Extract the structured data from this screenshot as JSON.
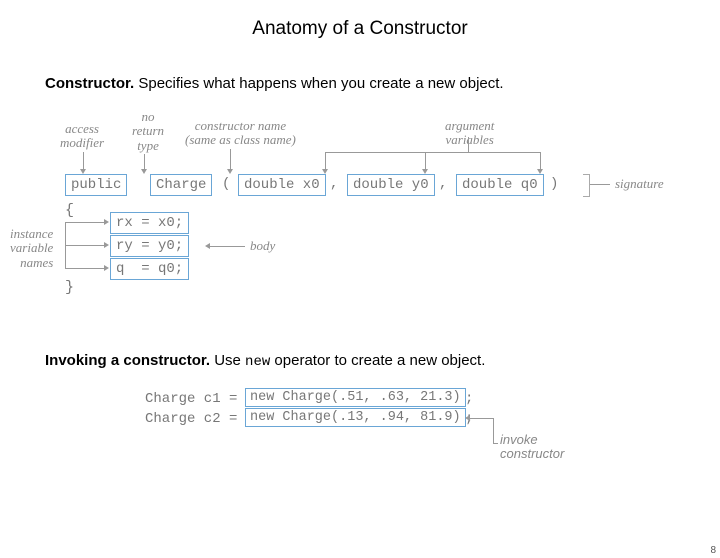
{
  "title": "Anatomy of a Constructor",
  "para1_bold": "Constructor.",
  "para1_rest": "  Specifies what happens when you create a new object.",
  "annotations": {
    "access_modifier": "access\nmodifier",
    "no_return_type": "no\nreturn\ntype",
    "constructor_name": "constructor name\n(same as class name)",
    "argument_variables": "argument\nvariables",
    "signature": "signature",
    "instance_variable_names": "instance\nvariable\nnames",
    "body": "body"
  },
  "code": {
    "sig_public": "public",
    "sig_charge": "Charge",
    "sig_paren_open": "(",
    "sig_arg1": "double x0",
    "sig_comma1": ",",
    "sig_arg2": "double y0",
    "sig_comma2": ",",
    "sig_arg3": "double q0",
    "sig_paren_close": ")",
    "brace_open": "{",
    "assign1": "rx = x0;",
    "assign2": "ry = y0;",
    "assign3": "q  = q0;",
    "brace_close": "}"
  },
  "para2_bold": "Invoking a constructor.",
  "para2_rest": "  Use ",
  "para2_mono": "new",
  "para2_rest2": " operator to create a new object.",
  "invoke": {
    "line1_a": "Charge c1 = ",
    "line1_b": "new Charge(.51, .63, 21.3)",
    "line1_c": ";",
    "line2_a": "Charge c2 = ",
    "line2_b": "new Charge(.13, .94, 81.9)",
    "line2_c": ";",
    "ann": "invoke\nconstructor"
  },
  "slide_number": "8"
}
